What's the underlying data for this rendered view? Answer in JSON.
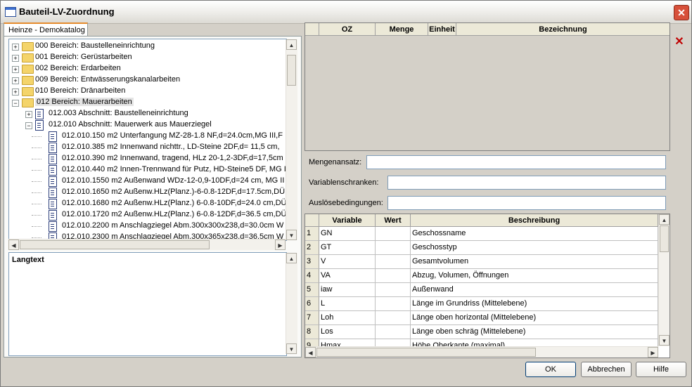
{
  "window": {
    "title": "Bauteil-LV-Zuordnung",
    "close": "✕"
  },
  "tab": {
    "label": "Heinze - Demokatalog"
  },
  "tree": [
    {
      "text": "000 Bereich: Baustelleneinrichtung",
      "kind": "folder",
      "level": 0,
      "expander": "+"
    },
    {
      "text": "001 Bereich: Gerüstarbeiten",
      "kind": "folder",
      "level": 0,
      "expander": "+"
    },
    {
      "text": "002 Bereich: Erdarbeiten",
      "kind": "folder",
      "level": 0,
      "expander": "+"
    },
    {
      "text": "009 Bereich: Entwässerungskanalarbeiten",
      "kind": "folder",
      "level": 0,
      "expander": "+"
    },
    {
      "text": "010 Bereich: Dränarbeiten",
      "kind": "folder",
      "level": 0,
      "expander": "+"
    },
    {
      "text": "012 Bereich: Mauerarbeiten",
      "kind": "folder",
      "level": 0,
      "expander": "−",
      "selected": true
    },
    {
      "text": "012.003 Abschnitt: Baustelleneinrichtung",
      "kind": "doc",
      "level": 1,
      "expander": "+"
    },
    {
      "text": "012.010 Abschnitt: Mauerwerk aus Mauerziegel",
      "kind": "doc",
      "level": 1,
      "expander": "−"
    },
    {
      "text": "012.010.150 m2 Unterfangung MZ-28-1.8 NF,d=24.0cm,MG III,F",
      "kind": "doc",
      "level": 2
    },
    {
      "text": "012.010.385 m2 Innenwand nichttr., LD-Steine 2DF,d= 11,5 cm,",
      "kind": "doc",
      "level": 2
    },
    {
      "text": "012.010.390 m2 Innenwand, tragend, HLz 20-1,2-3DF,d=17,5cm",
      "kind": "doc",
      "level": 2
    },
    {
      "text": "012.010.440 m2 Innen-Trennwand für Putz, HD-Steine5 DF, MG I",
      "kind": "doc",
      "level": 2
    },
    {
      "text": "012.010.1550 m2 Außenwand WDz-12-0,9-10DF,d=24 cm, MG II",
      "kind": "doc",
      "level": 2
    },
    {
      "text": "012.010.1650 m2 Außenw.HLz(Planz.)-6-0.8-12DF,d=17.5cm,DÜ",
      "kind": "doc",
      "level": 2
    },
    {
      "text": "012.010.1680 m2 Außenw.HLz(Planz.) 6-0.8-10DF,d=24.0 cm,DÜ",
      "kind": "doc",
      "level": 2
    },
    {
      "text": "012.010.1720 m2 Außenw.HLz(Planz.) 6-0.8-12DF,d=36.5 cm,DÜ",
      "kind": "doc",
      "level": 2
    },
    {
      "text": "012.010.2200 m Anschlagziegel Abm.300x300x238,d=30.0cm W",
      "kind": "doc",
      "level": 2
    },
    {
      "text": "012.010.2300 m Anschlagziegel Abm.300x365x238,d=36.5cm W",
      "kind": "doc",
      "level": 2
    }
  ],
  "langtext": {
    "label": "Langtext"
  },
  "lv_table": {
    "headers": [
      "",
      "OZ",
      "Menge",
      "Einheit",
      "Bezeichnung"
    ]
  },
  "fields": {
    "mengenansatz": {
      "label": "Mengenansatz:",
      "value": ""
    },
    "variablenschranken": {
      "label": "Variablenschranken:",
      "value": ""
    },
    "ausloesebedingungen": {
      "label": "Auslösebedingungen:",
      "value": ""
    }
  },
  "var_table": {
    "headers": [
      "",
      "Variable",
      "Wert",
      "Beschreibung"
    ],
    "rows": [
      {
        "n": "1",
        "var": "GN",
        "wert": "",
        "desc": "Geschossname"
      },
      {
        "n": "2",
        "var": "GT",
        "wert": "",
        "desc": "Geschosstyp"
      },
      {
        "n": "3",
        "var": "V",
        "wert": "",
        "desc": "Gesamtvolumen"
      },
      {
        "n": "4",
        "var": "VA",
        "wert": "",
        "desc": "Abzug, Volumen, Öffnungen"
      },
      {
        "n": "5",
        "var": "iaw",
        "wert": "",
        "desc": "Außenwand"
      },
      {
        "n": "6",
        "var": "L",
        "wert": "",
        "desc": "Länge im Grundriss (Mittelebene)"
      },
      {
        "n": "7",
        "var": "Loh",
        "wert": "",
        "desc": "Länge oben horizontal (Mittelebene)"
      },
      {
        "n": "8",
        "var": "Los",
        "wert": "",
        "desc": "Länge oben schräg (Mittelebene)"
      },
      {
        "n": "9",
        "var": "Hmax",
        "wert": "",
        "desc": "Höhe Oberkante (maximal)"
      }
    ]
  },
  "buttons": {
    "ok": "OK",
    "cancel": "Abbrechen",
    "help": "Hilfe"
  },
  "colors": {
    "close": "#d7503a",
    "tab_accent": "#e68b2c",
    "delete_x": "#c00000"
  }
}
